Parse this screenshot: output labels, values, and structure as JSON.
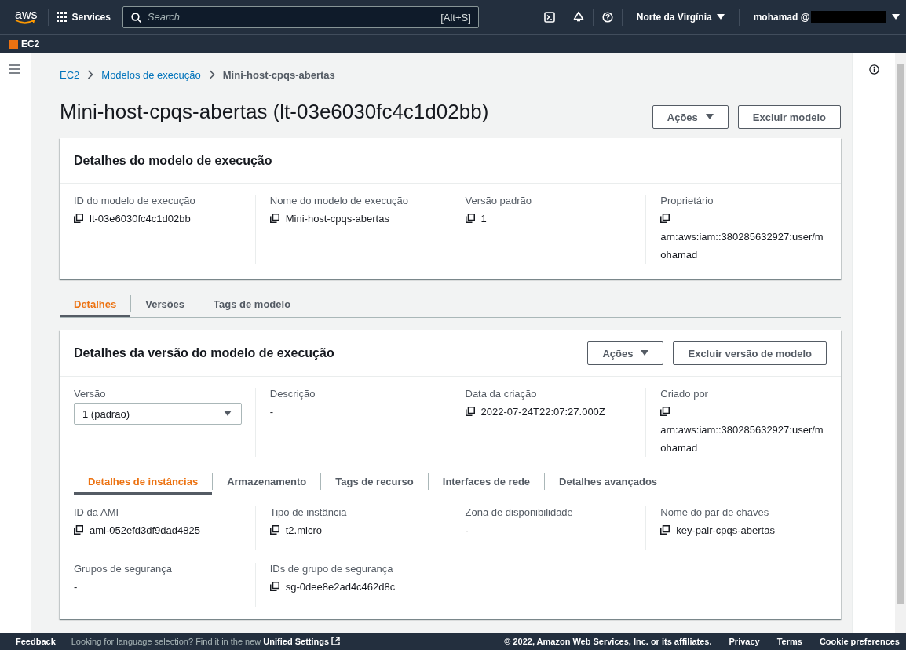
{
  "topbar": {
    "logo": "aws",
    "services": "Services",
    "search_placeholder": "Search",
    "search_shortcut": "[Alt+S]",
    "region": "Norte da Virgínia",
    "user": "mohamad @"
  },
  "service": {
    "name": "EC2"
  },
  "breadcrumb": [
    {
      "label": "EC2",
      "link": true
    },
    {
      "label": "Modelos de execução",
      "link": true
    },
    {
      "label": "Mini-host-cpqs-abertas",
      "link": false
    }
  ],
  "title": "Mini-host-cpqs-abertas (lt-03e6030fc4c1d02bb)",
  "actions": [
    {
      "label": "Ações",
      "kind": "dropdown"
    },
    {
      "label": "Excluir modelo",
      "kind": "plain"
    }
  ],
  "template_details": {
    "title": "Detalhes do modelo de execução",
    "fields": [
      {
        "label": "ID do modelo de execução",
        "kind": "text",
        "value": "lt-03e6030fc4c1d02bb",
        "copyable": true
      },
      {
        "label": "Nome do modelo de execução",
        "kind": "text",
        "value": "Mini-host-cpqs-abertas",
        "copyable": true
      },
      {
        "label": "Versão padrão",
        "kind": "text",
        "value": "1",
        "copyable": true
      },
      {
        "label": "Proprietário",
        "kind": "text",
        "value": "arn:aws:iam::380285632927:user/mohamad",
        "copyable": true
      }
    ]
  },
  "tabs": [
    {
      "label": "Detalhes",
      "selected": true
    },
    {
      "label": "Versões",
      "selected": false
    },
    {
      "label": "Tags de modelo",
      "selected": false
    }
  ],
  "version_details": {
    "title": "Detalhes da versão do modelo de execução",
    "actions": [
      {
        "label": "Ações",
        "kind": "dropdown"
      },
      {
        "label": "Excluir versão de modelo",
        "kind": "plain"
      }
    ],
    "fields": [
      {
        "label": "Versão",
        "kind": "select",
        "value": "1 (padrão)"
      },
      {
        "label": "Descrição",
        "kind": "text",
        "value": "-",
        "copyable": false
      },
      {
        "label": "Data da criação",
        "kind": "text",
        "value": "2022-07-24T22:07:27.000Z",
        "copyable": true
      },
      {
        "label": "Criado por",
        "kind": "text",
        "value": "arn:aws:iam::380285632927:user/mohamad",
        "copyable": true
      }
    ],
    "tabs": [
      {
        "label": "Detalhes de instâncias",
        "selected": true
      },
      {
        "label": "Armazenamento",
        "selected": false
      },
      {
        "label": "Tags de recurso",
        "selected": false
      },
      {
        "label": "Interfaces de rede",
        "selected": false
      },
      {
        "label": "Detalhes avançados",
        "selected": false
      }
    ],
    "instance_fields": [
      {
        "label": "ID da AMI",
        "kind": "text",
        "value": "ami-052efd3df9dad4825",
        "copyable": true
      },
      {
        "label": "Tipo de instância",
        "kind": "text",
        "value": "t2.micro",
        "copyable": true
      },
      {
        "label": "Zona de disponibilidade",
        "kind": "text",
        "value": "-",
        "copyable": false
      },
      {
        "label": "Nome do par de chaves",
        "kind": "text",
        "value": "key-pair-cpqs-abertas",
        "copyable": true
      },
      {
        "label": "Grupos de segurança",
        "kind": "text",
        "value": "-",
        "copyable": false
      },
      {
        "label": "IDs de grupo de segurança",
        "kind": "text",
        "value": "sg-0dee8e2ad4c462d8c",
        "copyable": true
      }
    ]
  },
  "footer": {
    "feedback": "Feedback",
    "language_hint": "Looking for language selection? Find it in the new",
    "language_link": "Unified Settings",
    "copyright": "© 2022, Amazon Web Services, Inc. or its affiliates.",
    "links": [
      "Privacy",
      "Terms",
      "Cookie preferences"
    ]
  }
}
